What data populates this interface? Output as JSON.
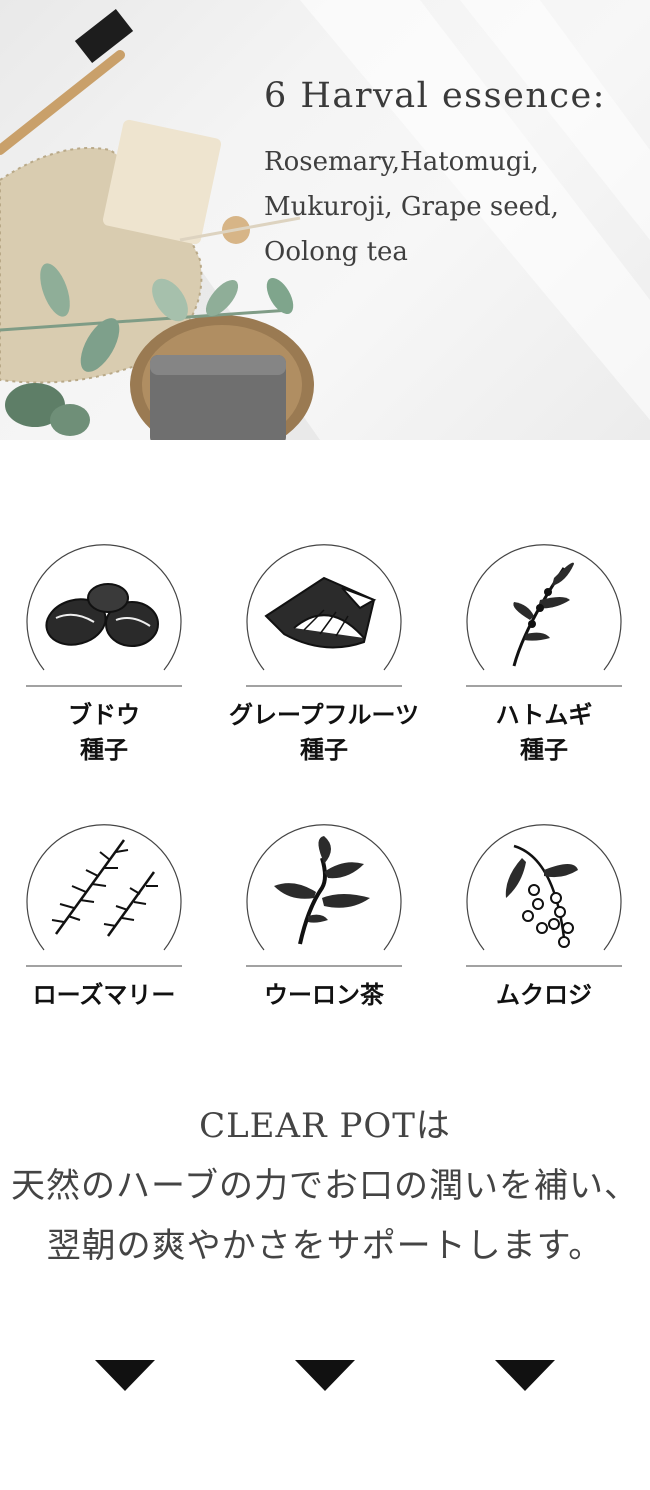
{
  "hero": {
    "title": "6 Harval essence:",
    "lines": [
      "Rosemary,Hatomugi,",
      "Mukuroji, Grape seed,",
      "Oolong tea"
    ]
  },
  "herbs": [
    {
      "label1": "ブドウ",
      "label2": "種子",
      "icon": "grape-seed-icon"
    },
    {
      "label1": "グレープフルーツ",
      "label2": "種子",
      "icon": "grapefruit-icon"
    },
    {
      "label1": "ハトムギ",
      "label2": "種子",
      "icon": "hatomugi-icon"
    },
    {
      "label1": "ローズマリー",
      "label2": "",
      "icon": "rosemary-icon"
    },
    {
      "label1": "ウーロン茶",
      "label2": "",
      "icon": "oolong-tea-icon"
    },
    {
      "label1": "ムクロジ",
      "label2": "",
      "icon": "mukuroji-icon"
    }
  ],
  "message": {
    "line1": "CLEAR POTは",
    "line2": "天然のハーブの力でお口の潤いを補い、",
    "line3": "翌朝の爽やかさをサポートします。"
  },
  "arrows": [
    "down-arrow-icon",
    "down-arrow-icon",
    "down-arrow-icon"
  ]
}
